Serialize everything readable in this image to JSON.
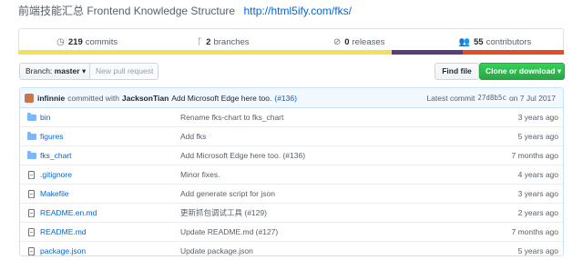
{
  "repo": {
    "description": "前端技能汇总 Frontend Knowledge Structure",
    "website": "http://html5ify.com/fks/"
  },
  "stats": {
    "commits": {
      "count": "219",
      "label": "commits"
    },
    "branches": {
      "count": "2",
      "label": "branches"
    },
    "releases": {
      "count": "0",
      "label": "releases"
    },
    "contributors": {
      "count": "55",
      "label": "contributors"
    }
  },
  "languages": [
    {
      "color": "#f1e05a",
      "share": 0.685
    },
    {
      "color": "#563d7c",
      "share": 0.13
    },
    {
      "color": "#e34c26",
      "share": 0.185
    }
  ],
  "toolbar": {
    "branch_prefix": "Branch:",
    "branch_name": "master",
    "new_pr": "New pull request",
    "find_file": "Find file",
    "clone": "Clone or download ▾"
  },
  "latest_commit": {
    "author": "infinnie",
    "committed_with": "committed with",
    "coauthor": "JacksonTian",
    "message": "Add Microsoft Edge here too.",
    "issue": "(#136)",
    "label": "Latest commit",
    "sha": "27d8b5c",
    "date": "on 7 Jul 2017"
  },
  "files": [
    {
      "type": "dir",
      "name": "bin",
      "message": "Rename fks-chart to fks_chart",
      "age": "3 years ago"
    },
    {
      "type": "dir",
      "name": "figures",
      "message": "Add fks",
      "age": "5 years ago"
    },
    {
      "type": "dir",
      "name": "fks_chart",
      "message": "Add Microsoft Edge here too. (#136)",
      "age": "7 months ago"
    },
    {
      "type": "file",
      "name": ".gitignore",
      "message": "Minor fixes.",
      "age": "4 years ago"
    },
    {
      "type": "file",
      "name": "Makefile",
      "message": "Add generate script for json",
      "age": "3 years ago"
    },
    {
      "type": "file",
      "name": "README.en.md",
      "message": "更新抓包调试工具 (#129)",
      "age": "2 years ago"
    },
    {
      "type": "file",
      "name": "README.md",
      "message": "Update README.md (#127)",
      "age": "7 months ago"
    },
    {
      "type": "file",
      "name": "package.json",
      "message": "Update package.json",
      "age": "5 years ago"
    }
  ]
}
